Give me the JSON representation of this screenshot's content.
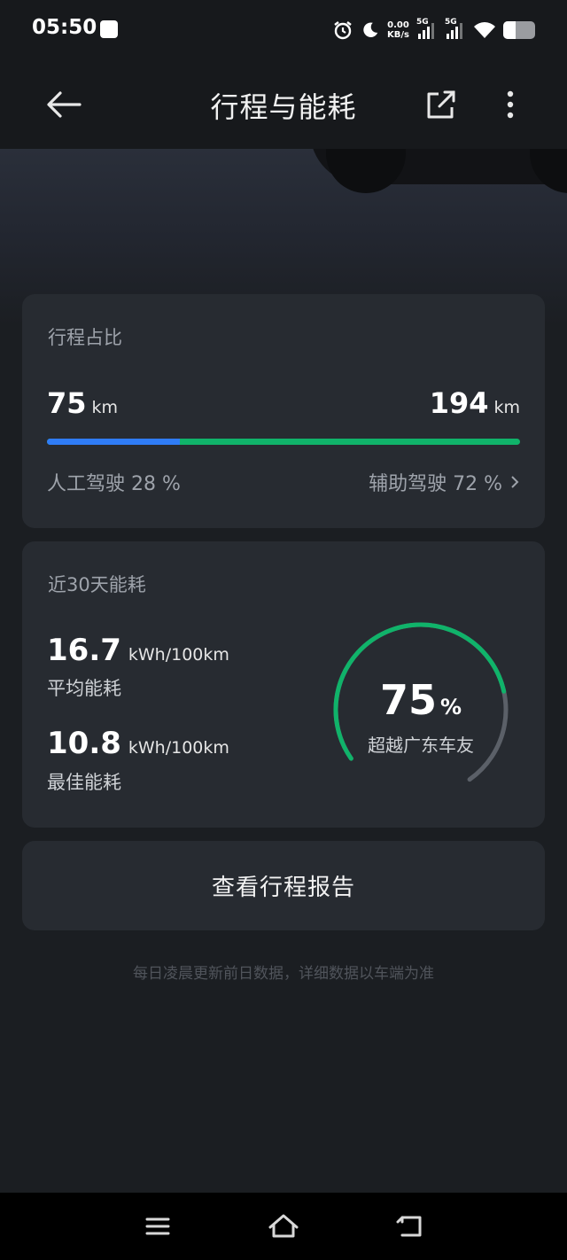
{
  "status_bar": {
    "time": "05:50",
    "net_speed_value": "0.00",
    "net_speed_unit": "KB/s",
    "signal_1": "5G",
    "signal_2": "5G",
    "icons": [
      "notification-icon",
      "alarm-icon",
      "moon-icon",
      "wifi-icon",
      "battery-icon"
    ]
  },
  "header": {
    "title": "行程与能耗",
    "icons": [
      "back-arrow-icon",
      "share-icon",
      "more-icon"
    ]
  },
  "trip_card": {
    "title": "行程占比",
    "manual_km": "75",
    "assisted_km": "194",
    "km_unit": "km",
    "manual_label": "人工驾驶 28 %",
    "assisted_label": "辅助驾驶 72 %",
    "manual_fraction": 0.28,
    "colors": {
      "manual": "#2f7cf6",
      "assisted": "#10b36a"
    }
  },
  "energy_card": {
    "title": "近30天能耗",
    "avg_value": "16.7",
    "avg_unit": "kWh/100km",
    "avg_label": "平均能耗",
    "best_value": "10.8",
    "best_unit": "kWh/100km",
    "best_label": "最佳能耗",
    "gauge_percent": "75",
    "gauge_percent_sign": "%",
    "gauge_fraction": 0.75,
    "gauge_label": "超越广东车友",
    "colors": {
      "gauge_fill": "#10b36a",
      "gauge_track": "#5b6068"
    }
  },
  "report_button": {
    "label": "查看行程报告"
  },
  "footnote": "每日凌晨更新前日数据，详细数据以车端为准",
  "nav_bar": {
    "icons": [
      "menu-icon",
      "home-icon",
      "back-icon"
    ]
  }
}
